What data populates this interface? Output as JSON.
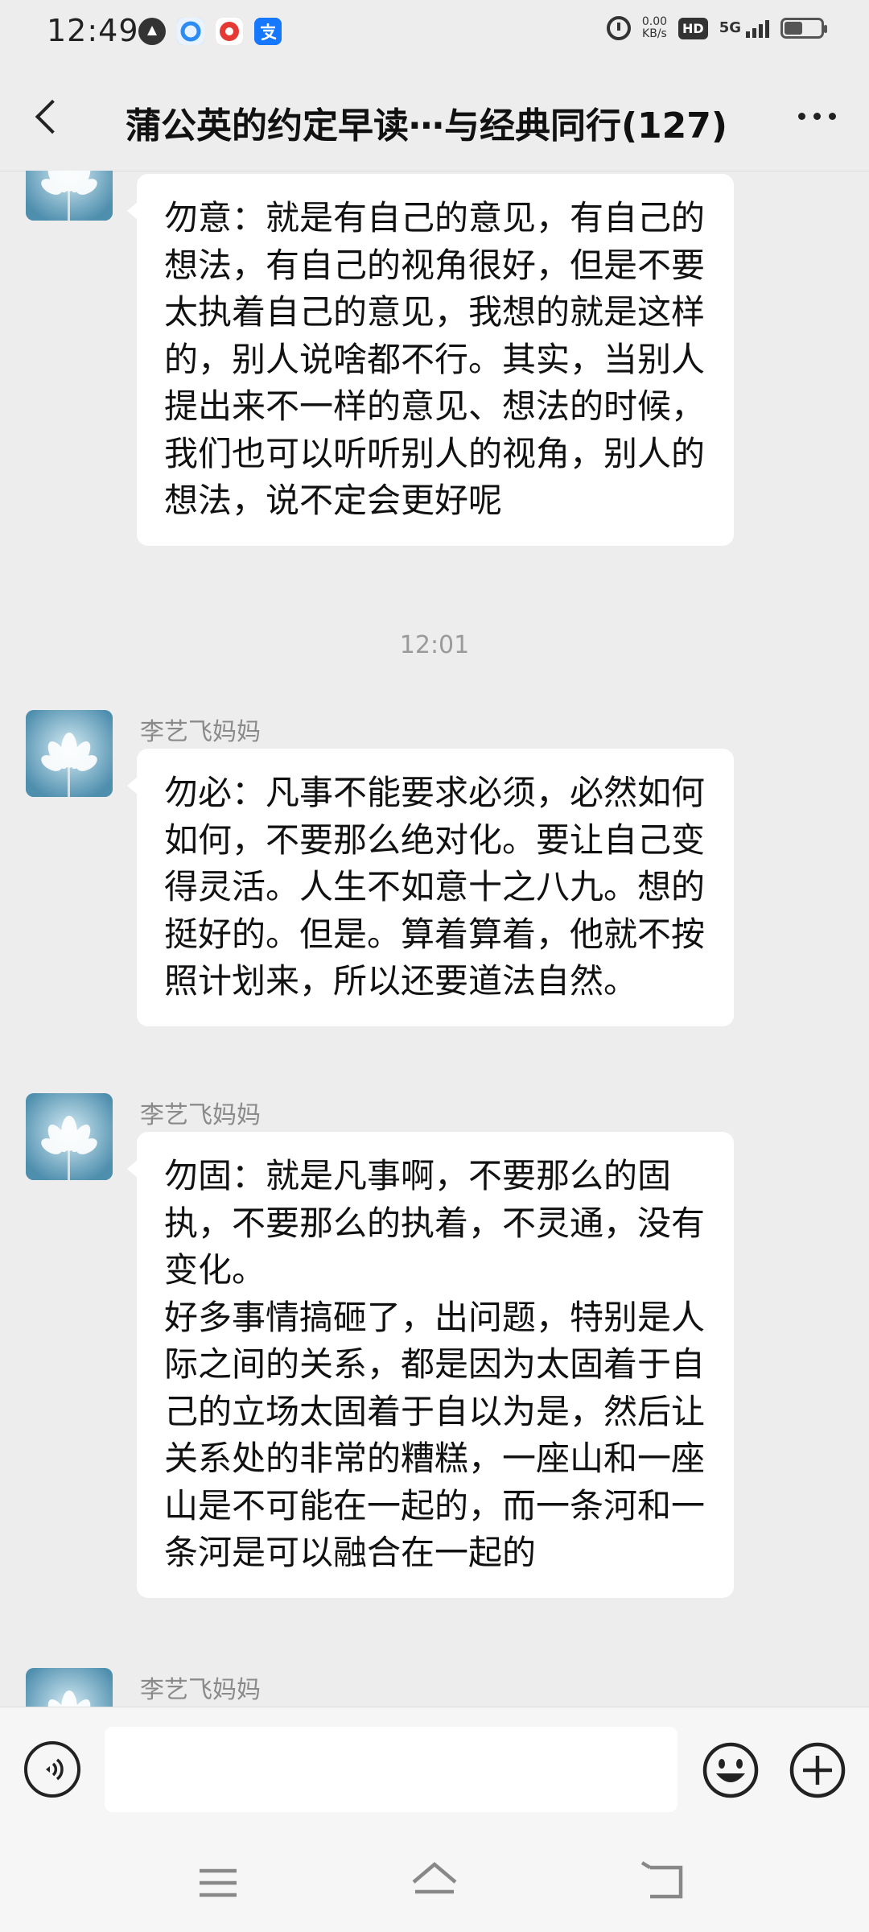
{
  "status_bar": {
    "time": "12:49",
    "net_speed_value": "0.00",
    "net_speed_unit": "KB/s",
    "hd_label": "HD",
    "network_label": "5G",
    "icons": [
      "app-icon",
      "browser-icon",
      "red-app-icon",
      "alipay-icon",
      "alarm-icon",
      "signal-icon",
      "battery-icon"
    ]
  },
  "header": {
    "title": "蒲公英的约定早读⋯与经典同行(127)",
    "back_icon": "back-arrow-icon",
    "more_icon": "more-icon"
  },
  "messages": [
    {
      "sender": "",
      "text": "勿意：就是有自己的意见，有自己的想法，有自己的视角很好，但是不要太执着自己的意见，我想的就是这样的，别人说啥都不行。其实，当别人提出来不一样的意见、想法的时候，我们也可以听听别人的视角，别人的想法，说不定会更好呢"
    },
    {
      "sender": "李艺飞妈妈",
      "text": "勿必：凡事不能要求必须，必然如何如何，不要那么绝对化。要让自己变得灵活。人生不如意十之八九。想的挺好的。但是。算着算着，他就不按照计划来，所以还要道法自然。"
    },
    {
      "sender": "李艺飞妈妈",
      "text": "勿固：就是凡事啊，不要那么的固执，不要那么的执着，不灵通，没有变化。\n好多事情搞砸了，出问题，特别是人际之间的关系，都是因为太固着于自己的立场太固着于自以为是，然后让关系处的非常的糟糕，一座山和一座山是不可能在一起的，而一条河和一条河是可以融合在一起的"
    },
    {
      "sender": "李艺飞妈妈",
      "text": ""
    }
  ],
  "time_divider": "12:01",
  "input_bar": {
    "placeholder": "",
    "voice_icon": "voice-icon",
    "emoji_icon": "emoji-icon",
    "plus_icon": "plus-icon"
  },
  "nav_bar": {
    "icons": [
      "menu-icon",
      "home-icon",
      "back-icon"
    ]
  },
  "colors": {
    "background": "#ededed",
    "bubble": "#ffffff",
    "sender_name": "#8a8a8a",
    "text": "#111111"
  }
}
